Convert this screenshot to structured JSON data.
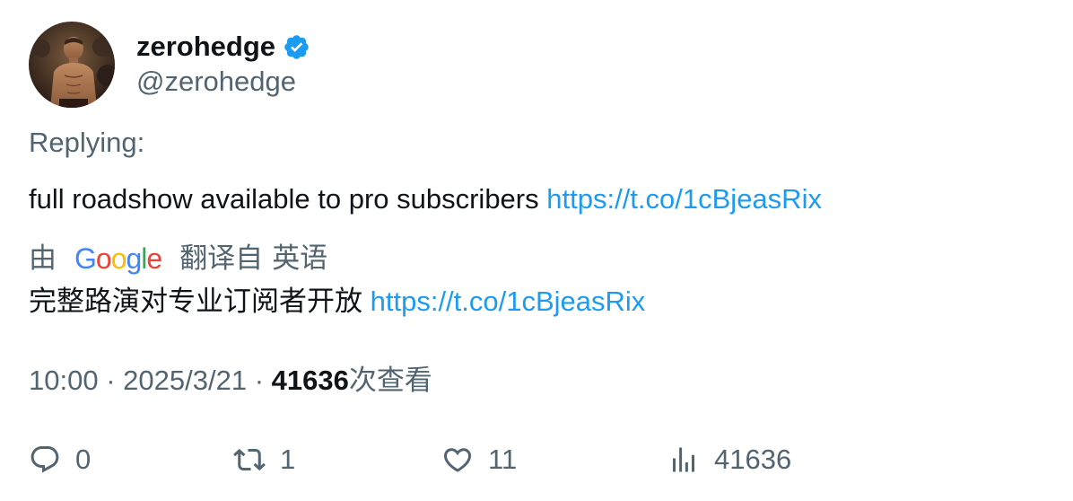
{
  "author": {
    "display_name": "zerohedge",
    "handle": "@zerohedge",
    "verified": true
  },
  "replying": {
    "label": "Replying:"
  },
  "tweet": {
    "text": "full roadshow available to pro subscribers",
    "link": "https://t.co/1cBjeasRix"
  },
  "translation": {
    "prefix": "由",
    "provider_letters": [
      "G",
      "o",
      "o",
      "g",
      "l",
      "e"
    ],
    "suffix_1": "翻译自",
    "suffix_2": "英语",
    "text": "完整路演对专业订阅者开放",
    "link": "https://t.co/1cBjeasRix"
  },
  "meta": {
    "time": "10:00",
    "separator": "·",
    "date": "2025/3/21",
    "views_count": "41636",
    "views_label": "次查看"
  },
  "actions": {
    "reply_count": "0",
    "retweet_count": "1",
    "like_count": "11",
    "views_count": "41636"
  },
  "colors": {
    "text_primary": "#0f1419",
    "text_secondary": "#536471",
    "link": "#1d9bf0",
    "verified": "#1d9bf0"
  },
  "icons": {
    "verified": "verified-badge-icon",
    "reply": "reply-bubble-icon",
    "retweet": "retweet-icon",
    "like": "heart-icon",
    "views": "bar-chart-icon"
  }
}
